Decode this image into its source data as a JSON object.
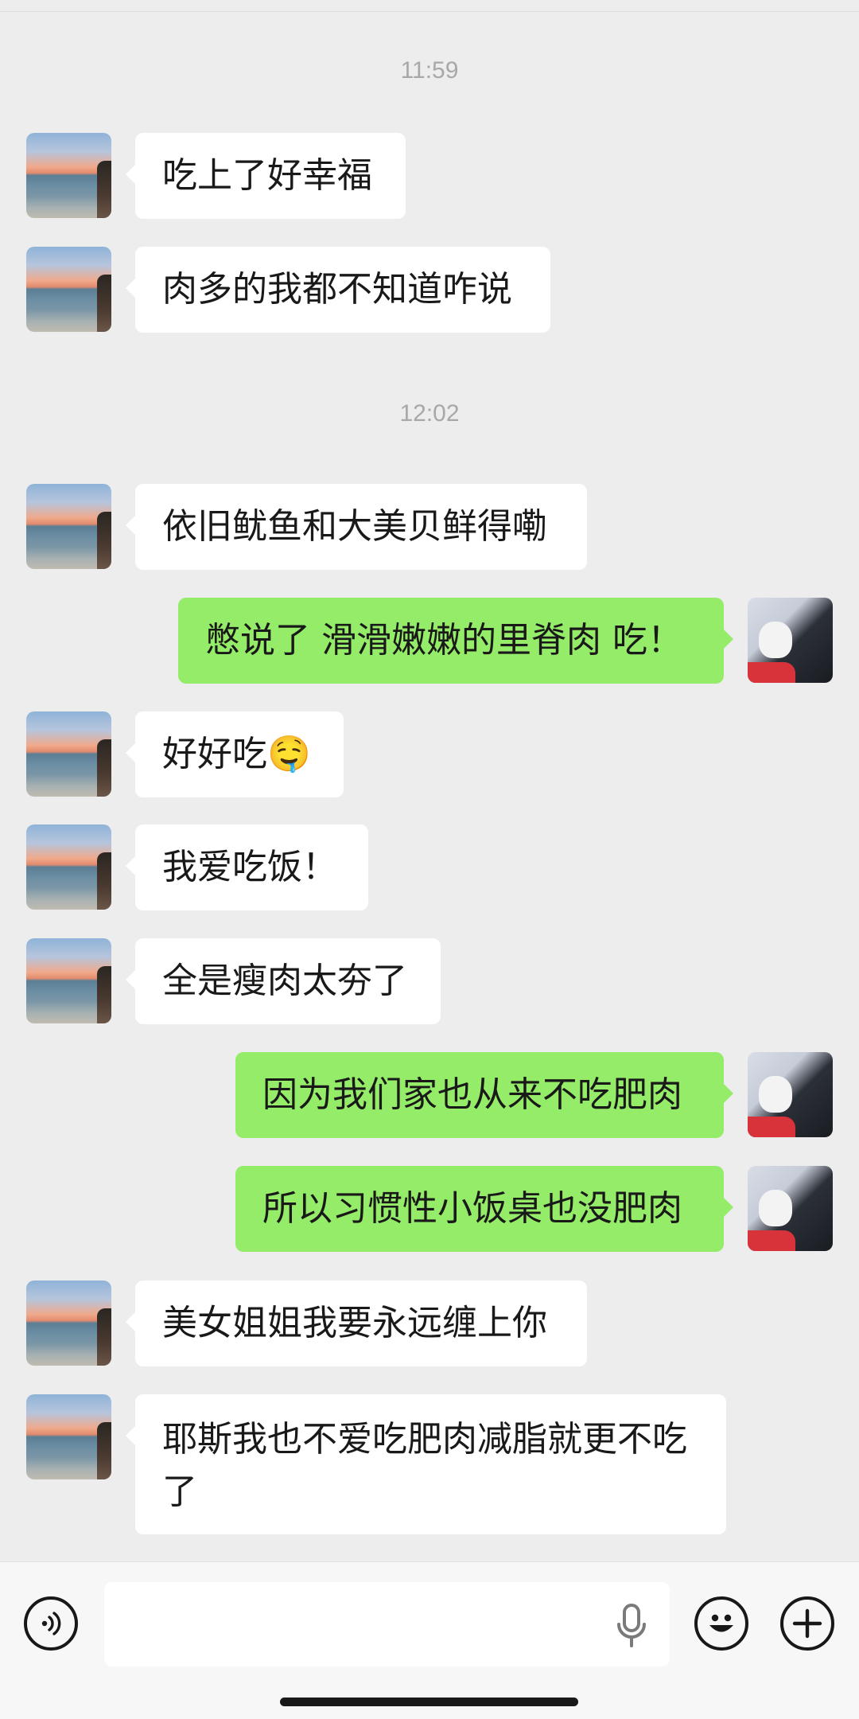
{
  "timestamps": [
    "11:59",
    "12:02"
  ],
  "messages": [
    {
      "side": "in",
      "text": "吃上了好幸福"
    },
    {
      "side": "in",
      "text": "肉多的我都不知道咋说"
    },
    {
      "side": "in",
      "text": "依旧鱿鱼和大美贝鲜得嘞"
    },
    {
      "side": "out",
      "text": "憋说了 滑滑嫩嫩的里脊肉 吃！"
    },
    {
      "side": "in",
      "text": "好好吃🤤"
    },
    {
      "side": "in",
      "text": "我爱吃饭！"
    },
    {
      "side": "in",
      "text": "全是瘦肉太夯了"
    },
    {
      "side": "out",
      "text": "因为我们家也从来不吃肥肉"
    },
    {
      "side": "out",
      "text": "所以习惯性小饭桌也没肥肉"
    },
    {
      "side": "in",
      "text": "美女姐姐我要永远缠上你"
    },
    {
      "side": "in",
      "text": "耶斯我也不爱吃肥肉减脂就更不吃了"
    }
  ],
  "input": {
    "value": "",
    "placeholder": ""
  },
  "icons": {
    "voice": "voice-icon",
    "mic": "microphone-icon",
    "emoji": "emoji-icon",
    "plus": "plus-icon"
  },
  "colors": {
    "background": "#ededed",
    "incoming_bubble": "#ffffff",
    "outgoing_bubble": "#95ec69",
    "timestamp_text": "#a8a8a8"
  }
}
